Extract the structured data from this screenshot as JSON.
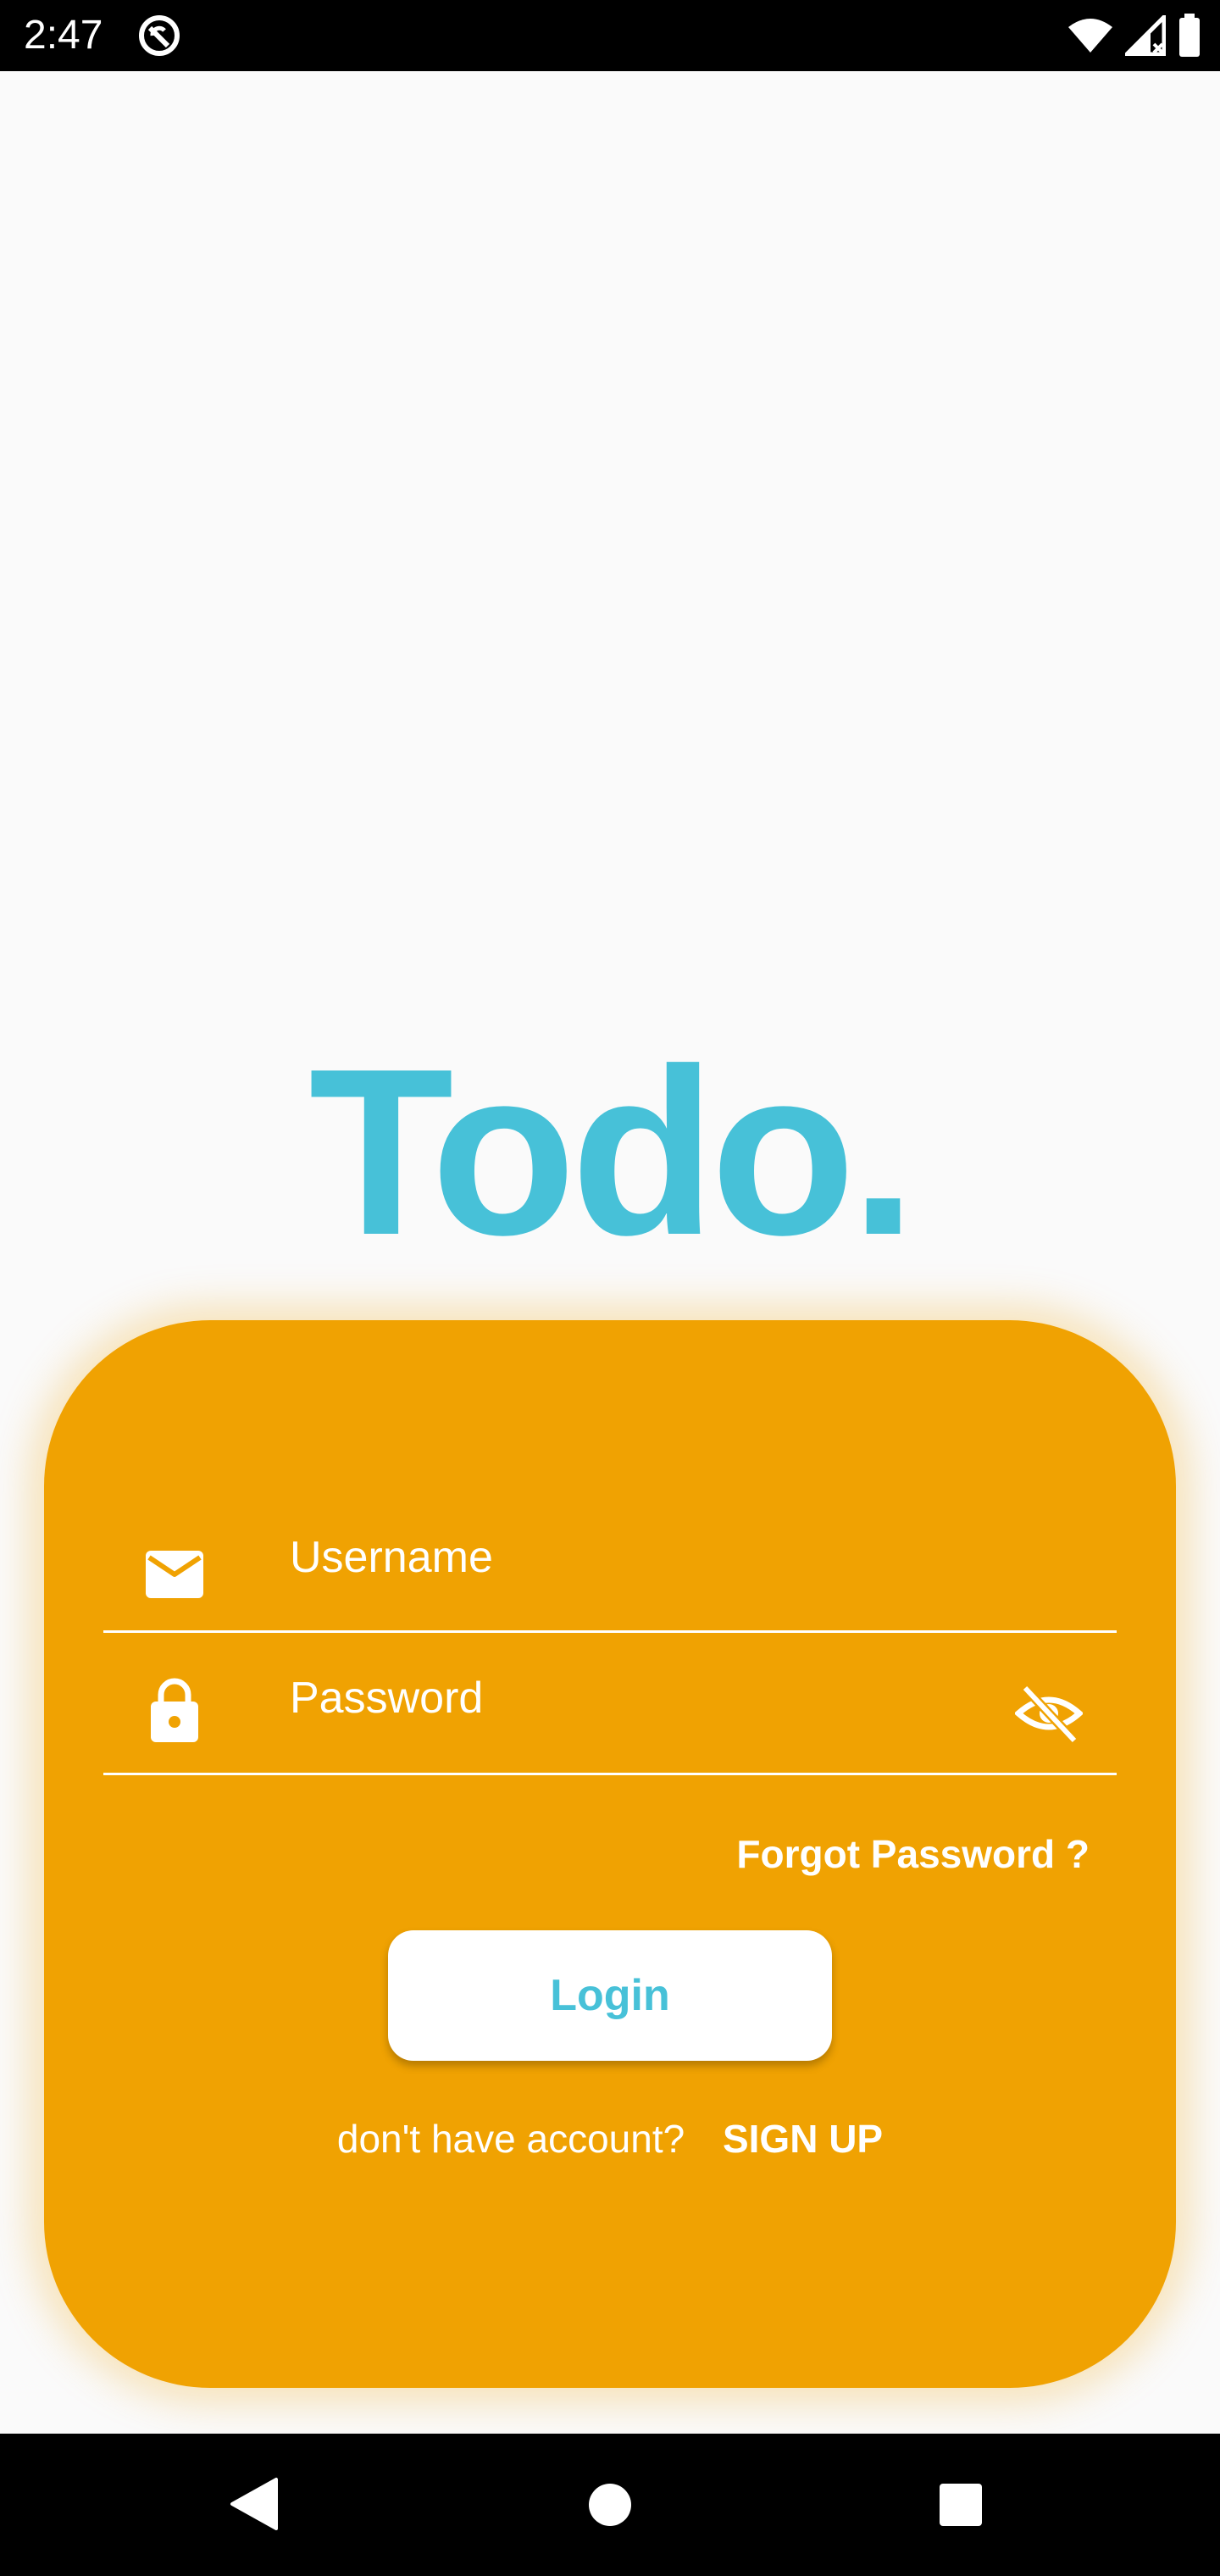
{
  "status_bar": {
    "time": "2:47",
    "icons": [
      "app-notification-icon",
      "wifi-icon",
      "cellular-signal-icon",
      "battery-icon"
    ]
  },
  "app": {
    "title": "Todo."
  },
  "login_form": {
    "username_placeholder": "Username",
    "password_placeholder": "Password",
    "forgot_password_label": "Forgot Password ?",
    "login_button_label": "Login",
    "signup_prompt": "don't have account?",
    "signup_link_label": "SIGN UP",
    "icons": {
      "username": "email-icon",
      "password": "lock-icon",
      "password_toggle": "eye-off-icon"
    }
  },
  "nav_bar": {
    "buttons": [
      "back-icon",
      "home-icon",
      "recents-icon"
    ]
  },
  "colors": {
    "accent": "#47c1d8",
    "card": "#f0a202",
    "background": "#fafafa",
    "system_bars": "#000000"
  }
}
